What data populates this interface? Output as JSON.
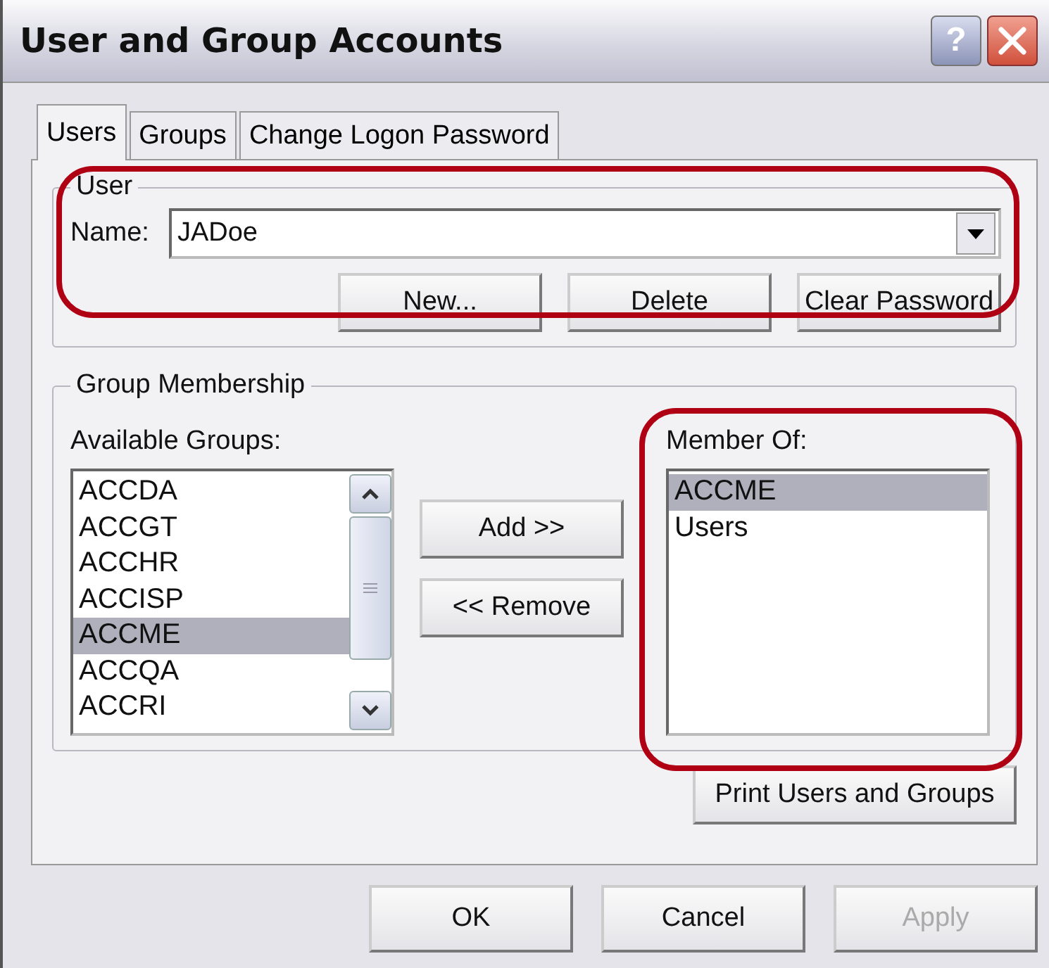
{
  "window": {
    "title": "User and Group Accounts",
    "help_button": "?"
  },
  "tabs": [
    {
      "label": "Users",
      "selected": true
    },
    {
      "label": "Groups",
      "selected": false
    },
    {
      "label": "Change Logon Password",
      "selected": false
    }
  ],
  "user": {
    "legend": "User",
    "name_label": "Name:",
    "name_value": "JADoe",
    "buttons": [
      "New...",
      "Delete",
      "Clear Password"
    ]
  },
  "group_membership": {
    "legend": "Group Membership",
    "available_label": "Available Groups:",
    "available_groups": [
      {
        "name": "ACCDA",
        "selected": false
      },
      {
        "name": "ACCGT",
        "selected": false
      },
      {
        "name": "ACCHR",
        "selected": false
      },
      {
        "name": "ACCISP",
        "selected": false
      },
      {
        "name": "ACCME",
        "selected": true
      },
      {
        "name": "ACCQA",
        "selected": false
      },
      {
        "name": "ACCRI",
        "selected": false
      }
    ],
    "add_button": "Add >>",
    "remove_button": "<< Remove",
    "member_label": "Member Of:",
    "member_of": [
      {
        "name": "ACCME",
        "selected": true
      },
      {
        "name": "Users",
        "selected": false
      }
    ]
  },
  "print_button": "Print Users and Groups",
  "footer_buttons": [
    {
      "label": "OK",
      "disabled": false
    },
    {
      "label": "Cancel",
      "disabled": false
    },
    {
      "label": "Apply",
      "disabled": true
    }
  ]
}
